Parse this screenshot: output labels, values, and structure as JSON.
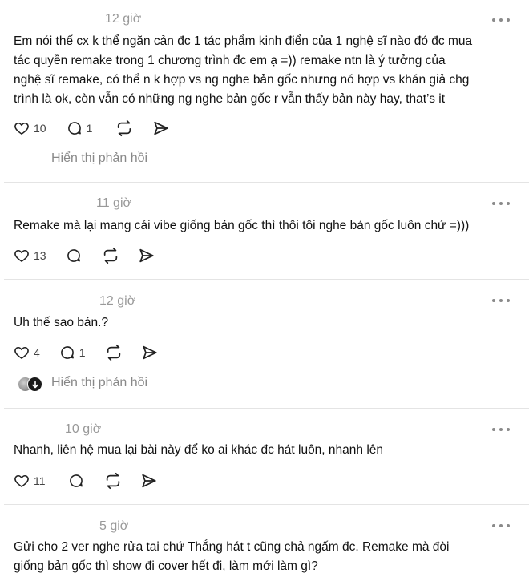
{
  "comments": [
    {
      "time": "12 giờ",
      "text": "Em nói thế cx k thể ngăn cản đc 1 tác phẩm kinh điển của 1 nghệ sĩ nào đó đc mua\ntác quyền remake trong 1 chương trình đc em ạ =)) remake ntn là ý tưởng của\nnghệ sĩ remake, có thể n k hợp vs ng nghe bản gốc nhưng nó hợp vs khán giả chg\ntrình là ok, còn vẫn có những ng nghe bản gốc r vẫn thấy bản này hay, that’s it",
      "likes": "10",
      "replies": "1",
      "show_replies": "Hiển thị phản hồi"
    },
    {
      "time": "11 giờ",
      "text": "Remake mà lại mang cái vibe giống bản gốc thì thôi tôi nghe bản gốc luôn chứ =)))",
      "likes": "13",
      "replies": ""
    },
    {
      "time": "12 giờ",
      "text": "Uh thế sao bán.?",
      "likes": "4",
      "replies": "1",
      "show_replies": "Hiển thị phản hồi"
    },
    {
      "time": "10 giờ",
      "text": "Nhanh, liên hệ mua lại bài này để ko ai khác đc hát luôn, nhanh lên",
      "likes": "11",
      "replies": ""
    },
    {
      "time": "5 giờ",
      "text": "Gửi cho 2 ver nghe rửa tai chứ Thắng hát t cũng chả ngấm đc. Remake mà đòi\ngiống bản gốc thì show đi cover hết đi, làm mới làm gì?"
    }
  ],
  "icons": {
    "like": "heart-icon",
    "reply": "comment-bubble-icon",
    "repost": "repost-icon",
    "share": "share-send-icon",
    "more": "more-dots-icon"
  }
}
